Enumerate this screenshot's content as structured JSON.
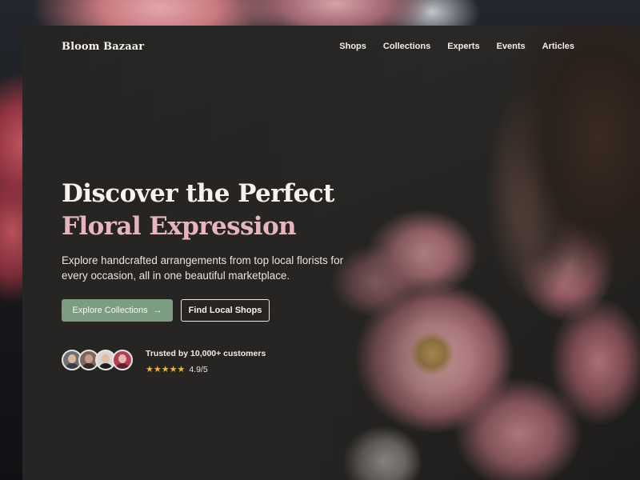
{
  "brand": {
    "name": "Bloom Bazaar"
  },
  "nav": {
    "items": [
      "Shops",
      "Collections",
      "Experts",
      "Events",
      "Articles"
    ]
  },
  "hero": {
    "title_main": "Discover the Perfect ",
    "title_accent": "Floral Expression",
    "subtitle": "Explore handcrafted arrangements from top local florists for every occasion, all in one beautiful marketplace.",
    "accent_color": "#e7b6bd"
  },
  "actions": {
    "primary_label": "Explore Collections",
    "primary_icon": "arrow-right-icon",
    "primary_color": "#7d9d83",
    "secondary_label": "Find Local Shops"
  },
  "trust": {
    "avatars": [
      "customer-avatar-1",
      "customer-avatar-2",
      "customer-avatar-3",
      "customer-avatar-4"
    ],
    "text": "Trusted by 10,000+ customers",
    "stars": "★★★★★",
    "rating": "4.9/5",
    "star_color": "#e8b54a"
  }
}
